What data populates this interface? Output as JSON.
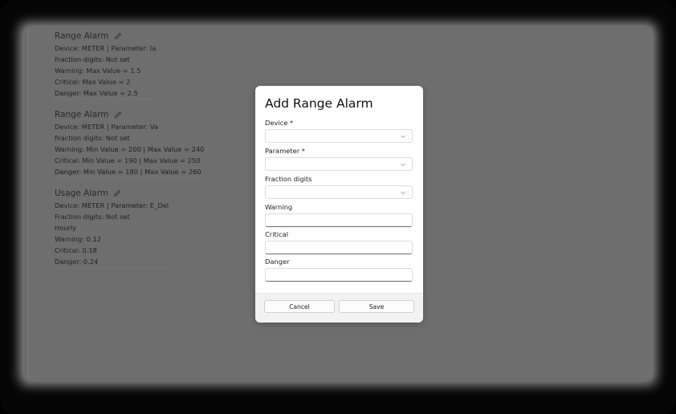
{
  "alarms": [
    {
      "title": "Range Alarm",
      "lines": [
        "Device: METER | Parameter: Ia",
        "Fraction digits: Not set",
        "Warning: Max Value = 1.5",
        "Critical: Max Value = 2",
        "Danger: Max Value = 2.5"
      ]
    },
    {
      "title": "Range Alarm",
      "lines": [
        "Device: METER | Parameter: Va",
        "Fraction digits: Not set",
        "Warning: Min Value = 200 | Max Value = 240",
        "Critical: Min Value = 190 | Max Value = 250",
        "Danger: Min Value = 180 | Max Value = 260"
      ]
    },
    {
      "title": "Usage Alarm",
      "lines": [
        "Device: METER | Parameter: E_Del",
        "Fraction digits: Not set",
        "Hourly",
        "Warning: 0.12",
        "Critical: 0.18",
        "Danger: 0.24"
      ]
    }
  ],
  "modal": {
    "title": "Add Range Alarm",
    "device_label": "Device *",
    "parameter_label": "Parameter *",
    "fraction_label": "Fraction digits",
    "warning_label": "Warning",
    "critical_label": "Critical",
    "danger_label": "Danger",
    "cancel_label": "Cancel",
    "save_label": "Save"
  },
  "icons": {
    "edit": "pencil-icon",
    "dropdown": "chevron-down-icon"
  },
  "colors": {
    "overlay": "#6e6e6e",
    "modal_bg": "#ffffff",
    "footer_bg": "#f2f2f2"
  }
}
